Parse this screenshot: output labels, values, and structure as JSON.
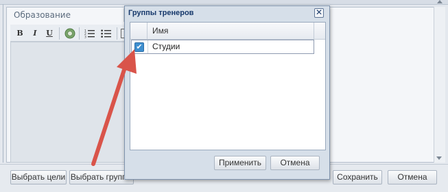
{
  "form": {
    "field_label": "Образование",
    "toolbar": {
      "bold": "B",
      "italic": "I",
      "underline": "U",
      "bullet_list_icon": "list-bullet-icon",
      "numbered_list_icon": "list-numbered-icon"
    }
  },
  "bottom_bar": {
    "select_goals": "Выбрать цели",
    "select_groups": "Выбрать группы",
    "save": "Сохранить",
    "cancel": "Отмена"
  },
  "dialog": {
    "title": "Группы тренеров",
    "close_glyph": "✕",
    "grid": {
      "column_name": "Имя",
      "rows": [
        {
          "name": "Студии",
          "checked": true,
          "check_glyph": "✔"
        }
      ]
    },
    "apply": "Применить",
    "cancel": "Отмена"
  },
  "colors": {
    "title": "#16386b",
    "checkbox": "#3f8fcf",
    "arrow": "#d9544a"
  }
}
